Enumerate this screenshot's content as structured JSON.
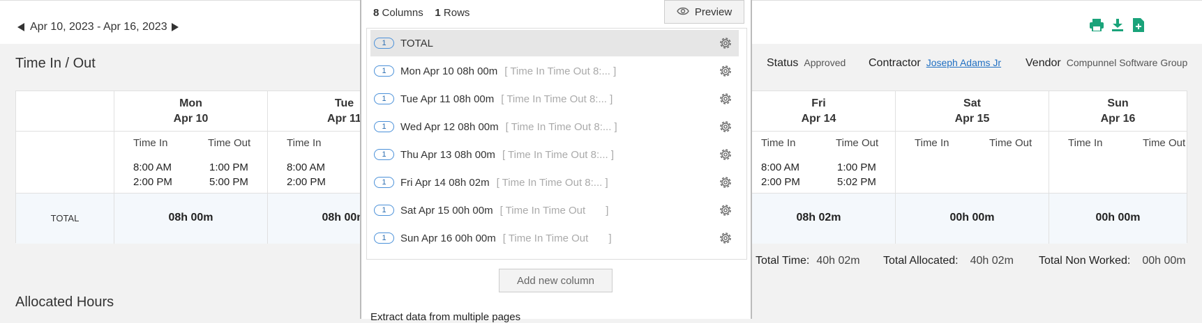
{
  "header": {
    "date_range": "Apr 10, 2023 - Apr 16, 2023"
  },
  "icons": {
    "print": "print-icon",
    "download": "download-icon",
    "export": "file-export-icon",
    "accent": "#1aa37a"
  },
  "timesheet": {
    "title": "Time In / Out",
    "status_label": "Status",
    "status_value": "Approved",
    "contractor_label": "Contractor",
    "contractor_value": "Joseph Adams Jr",
    "vendor_label": "Vendor",
    "vendor_value": "Compunnel Software Group",
    "time_in_label": "Time In",
    "time_out_label": "Time Out",
    "total_label": "TOTAL",
    "days": [
      {
        "day": "Mon",
        "date": "Apr 10",
        "in1": "8:00 AM",
        "out1": "1:00 PM",
        "in2": "2:00 PM",
        "out2": "5:00 PM",
        "total": "08h 00m"
      },
      {
        "day": "Tue",
        "date": "Apr 11",
        "in1": "8:00 AM",
        "out1": "",
        "in2": "2:00 PM",
        "out2": "",
        "total": "08h 00m"
      },
      {
        "day": "Fri",
        "date": "Apr 14",
        "in1": "8:00 AM",
        "out1": "1:00 PM",
        "in2": "2:00 PM",
        "out2": "5:02 PM",
        "total": "08h 02m"
      },
      {
        "day": "Sat",
        "date": "Apr 15",
        "in1": "",
        "out1": "",
        "in2": "",
        "out2": "",
        "total": "00h 00m"
      },
      {
        "day": "Sun",
        "date": "Apr 16",
        "in1": "",
        "out1": "",
        "in2": "",
        "out2": "",
        "total": "00h 00m"
      }
    ],
    "totals": {
      "total_time_label": "Total Time:",
      "total_time": "40h 02m",
      "allocated_label": "Total Allocated:",
      "allocated": "40h 02m",
      "non_worked_label": "Total Non Worked:",
      "non_worked": "00h 00m"
    }
  },
  "allocated_title": "Allocated Hours",
  "modal": {
    "columns_count": "8",
    "columns_label": "Columns",
    "rows_count": "1",
    "rows_label": "Rows",
    "preview_label": "Preview",
    "rows": [
      {
        "badge": "1",
        "label": "TOTAL",
        "hint": ""
      },
      {
        "badge": "1",
        "label": "Mon Apr 10 08h 00m",
        "hint": "[ Time In Time Out 8:... ]"
      },
      {
        "badge": "1",
        "label": "Tue Apr 11 08h 00m",
        "hint": "[ Time In Time Out 8:... ]"
      },
      {
        "badge": "1",
        "label": "Wed Apr 12 08h 00m",
        "hint": "[ Time In Time Out 8:... ]"
      },
      {
        "badge": "1",
        "label": "Thu Apr 13 08h 00m",
        "hint": "[ Time In Time Out 8:... ]"
      },
      {
        "badge": "1",
        "label": "Fri Apr 14 08h 02m",
        "hint": "[ Time In Time Out 8:... ]"
      },
      {
        "badge": "1",
        "label": "Sat Apr 15 00h 00m",
        "hint": "[ Time In Time Out       ]"
      },
      {
        "badge": "1",
        "label": "Sun Apr 16 00h 00m",
        "hint": "[ Time In Time Out       ]"
      }
    ],
    "add_column_label": "Add new column",
    "extract_label": "Extract data from multiple pages"
  }
}
